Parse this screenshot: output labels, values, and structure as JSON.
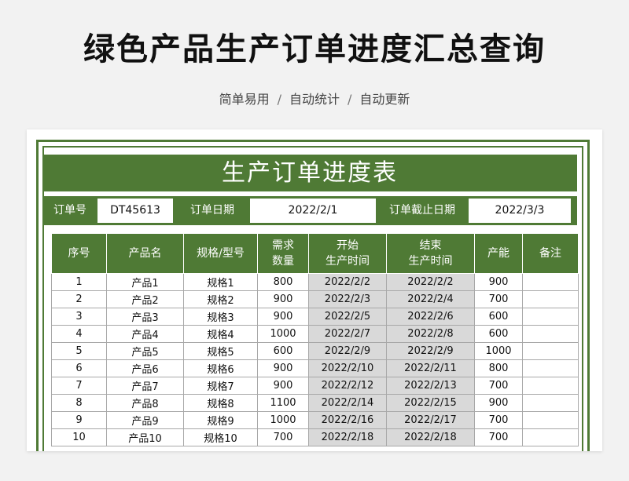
{
  "header": {
    "title": "绿色产品生产订单进度汇总查询",
    "tags": [
      "简单易用",
      "自动统计",
      "自动更新"
    ],
    "separator": "/"
  },
  "sheet": {
    "title": "生产订单进度表",
    "info": {
      "order_no_label": "订单号",
      "order_no_value": "DT45613",
      "order_date_label": "订单日期",
      "order_date_value": "2022/2/1",
      "deadline_label": "订单截止日期",
      "deadline_value": "2022/3/3"
    },
    "columns": [
      [
        "序号"
      ],
      [
        "产品名"
      ],
      [
        "规格/型号"
      ],
      [
        "需求",
        "数量"
      ],
      [
        "开始",
        "生产时间"
      ],
      [
        "结束",
        "生产时间"
      ],
      [
        "产能"
      ],
      [
        "备注"
      ]
    ],
    "rows": [
      [
        "1",
        "产品1",
        "规格1",
        "800",
        "2022/2/2",
        "2022/2/2",
        "900",
        ""
      ],
      [
        "2",
        "产品2",
        "规格2",
        "900",
        "2022/2/3",
        "2022/2/4",
        "700",
        ""
      ],
      [
        "3",
        "产品3",
        "规格3",
        "900",
        "2022/2/5",
        "2022/2/6",
        "600",
        ""
      ],
      [
        "4",
        "产品4",
        "规格4",
        "1000",
        "2022/2/7",
        "2022/2/8",
        "600",
        ""
      ],
      [
        "5",
        "产品5",
        "规格5",
        "600",
        "2022/2/9",
        "2022/2/9",
        "1000",
        ""
      ],
      [
        "6",
        "产品6",
        "规格6",
        "900",
        "2022/2/10",
        "2022/2/11",
        "800",
        ""
      ],
      [
        "7",
        "产品7",
        "规格7",
        "900",
        "2022/2/12",
        "2022/2/13",
        "700",
        ""
      ],
      [
        "8",
        "产品8",
        "规格8",
        "1100",
        "2022/2/14",
        "2022/2/15",
        "900",
        ""
      ],
      [
        "9",
        "产品9",
        "规格9",
        "1000",
        "2022/2/16",
        "2022/2/17",
        "700",
        ""
      ],
      [
        "10",
        "产品10",
        "规格10",
        "700",
        "2022/2/18",
        "2022/2/18",
        "700",
        ""
      ]
    ]
  },
  "colors": {
    "accent": "#4f7a35",
    "date_cell": "#d9d9d9"
  }
}
